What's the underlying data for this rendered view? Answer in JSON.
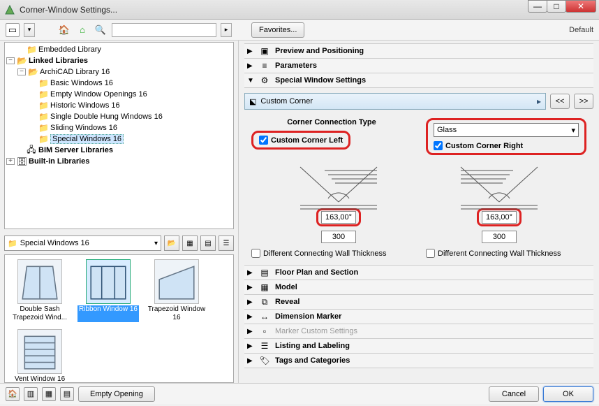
{
  "window": {
    "title": "Corner-Window Settings..."
  },
  "toolbar": {
    "favorites": "Favorites...",
    "default": "Default",
    "search_placeholder": ""
  },
  "tree": {
    "n0": "Embedded Library",
    "n1": "Linked Libraries",
    "n2": "ArchiCAD Library 16",
    "n3": "Basic Windows 16",
    "n4": "Empty Window Openings 16",
    "n5": "Historic Windows 16",
    "n6": "Single Double Hung Windows 16",
    "n7": "Sliding Windows 16",
    "n8": "Special Windows 16",
    "n9": "BIM Server Libraries",
    "n10": "Built-in Libraries"
  },
  "mid": {
    "folder": "Special Windows 16"
  },
  "thumbs": {
    "t0": "Double Sash Trapezoid Wind...",
    "t1": "Ribbon Window 16",
    "t2": "Trapezoid Window 16",
    "t3": "Vent Window 16"
  },
  "sections": {
    "s0": "Preview and Positioning",
    "s1": "Parameters",
    "s2": "Special Window Settings",
    "sub": "Custom Corner",
    "s3": "Floor Plan and Section",
    "s4": "Model",
    "s5": "Reveal",
    "s6": "Dimension Marker",
    "s7": "Marker Custom Settings",
    "s8": "Listing and Labeling",
    "s9": "Tags and Categories"
  },
  "opts": {
    "conn_title": "Corner Connection Type",
    "left": "Custom Corner Left",
    "right": "Custom Corner Right",
    "glass": "Glass",
    "angle_l": "163,00°",
    "angle_r": "163,00°",
    "width_l": "300",
    "width_r": "300",
    "diff": "Different Connecting Wall Thickness"
  },
  "nav": {
    "prev": "<<",
    "next": ">>"
  },
  "footer": {
    "empty": "Empty Opening",
    "cancel": "Cancel",
    "ok": "OK"
  }
}
